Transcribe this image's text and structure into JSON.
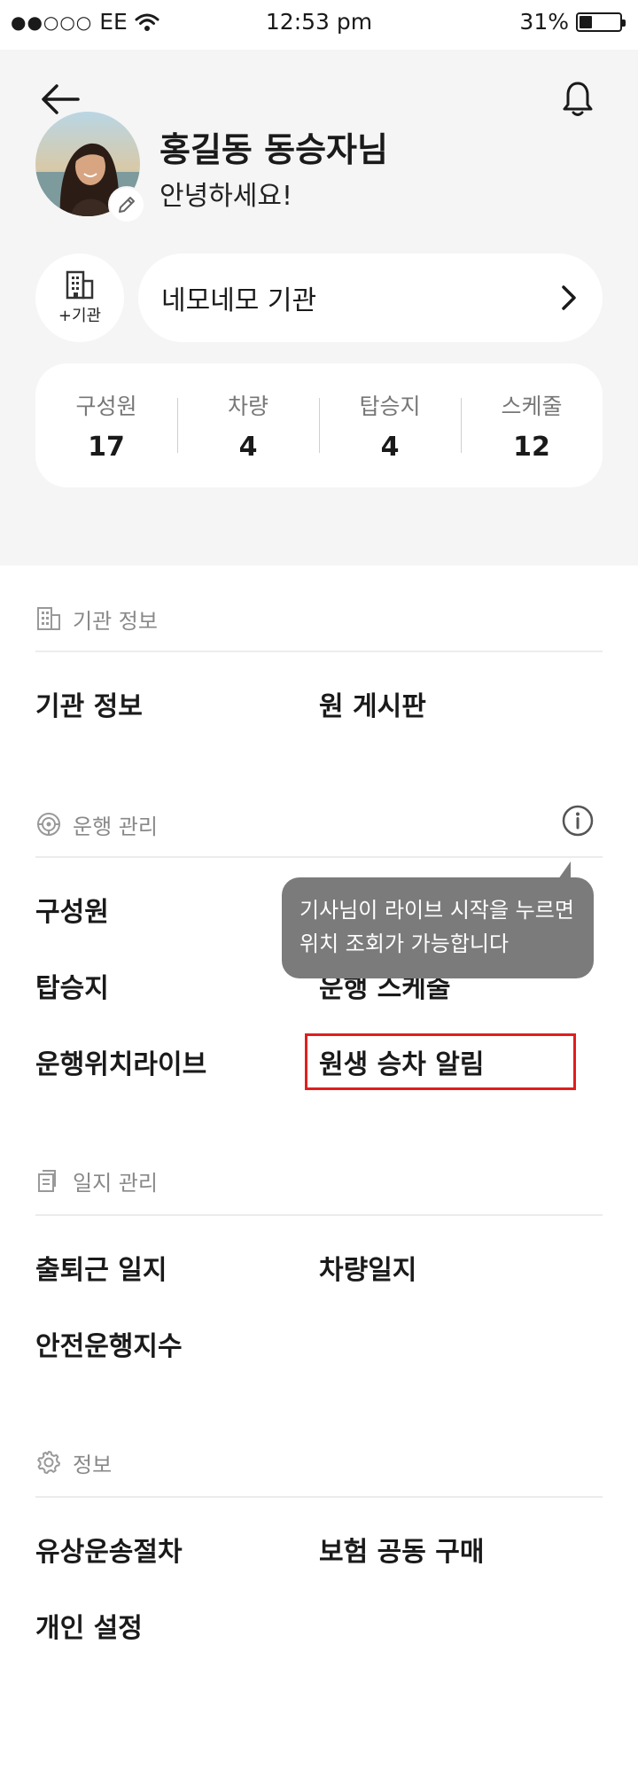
{
  "status_bar": {
    "carrier": "EE",
    "time": "12:53 pm",
    "battery_percent": "31%",
    "battery_level": 0.31
  },
  "header": {
    "back_icon": "arrow-left-icon",
    "notification_icon": "bell-icon"
  },
  "profile": {
    "name": "홍길동 동승자님",
    "greeting": "안녕하세요!",
    "edit_icon": "pencil-icon"
  },
  "organization": {
    "add_label": "+기관",
    "name": "네모네모 기관",
    "chevron_icon": "chevron-right-icon"
  },
  "stats": [
    {
      "label": "구성원",
      "value": "17"
    },
    {
      "label": "차량",
      "value": "4"
    },
    {
      "label": "탑승지",
      "value": "4"
    },
    {
      "label": "스케줄",
      "value": "12"
    }
  ],
  "sections": {
    "org_info": {
      "title": "기관 정보",
      "icon": "building-icon",
      "items": [
        "기관 정보",
        "원 게시판"
      ]
    },
    "operation": {
      "title": "운행 관리",
      "icon": "steering-wheel-icon",
      "items": [
        "구성원",
        "탑승지",
        "운행 스케줄",
        "운행위치라이브",
        "원생 승차 알림"
      ]
    },
    "log": {
      "title": "일지 관리",
      "icon": "copy-document-icon",
      "items": [
        "출퇴근 일지",
        "차량일지",
        "안전운행지수"
      ]
    },
    "info": {
      "title": "정보",
      "icon": "gear-icon",
      "items": [
        "유상운송절차",
        "보험 공동 구매",
        "개인 설정"
      ]
    }
  },
  "tooltip": {
    "line1": "기사님이 라이브 시작을 누르면",
    "line2": "위치 조회가 가능합니다"
  },
  "colors": {
    "background_top": "#f5f5f5",
    "card": "#ffffff",
    "tooltip": "#7b7b7b",
    "highlight": "#e01e1e"
  }
}
